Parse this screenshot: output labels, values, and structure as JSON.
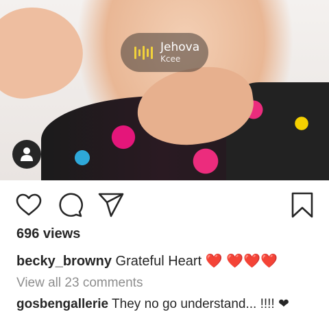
{
  "music_sticker": {
    "song": "Jehova",
    "artist": "Kcee",
    "icon": "equalizer-icon"
  },
  "actions": {
    "like_icon": "heart-icon",
    "comment_icon": "comment-bubble-icon",
    "share_icon": "paper-plane-icon",
    "save_icon": "bookmark-icon"
  },
  "post": {
    "views": "696 views",
    "caption_user": "becky_browny",
    "caption_text": "Grateful Heart ❤️ ❤️❤️❤️",
    "view_comments": "View all 23 comments",
    "first_comment_user": "gosbengallerie",
    "first_comment_text": "They no go understand... !!!! ❤"
  },
  "colors": {
    "text": "#262626",
    "muted": "#8e8e8e",
    "eq_yellow": "#f1d23b",
    "heart_red": "#e0201b"
  }
}
